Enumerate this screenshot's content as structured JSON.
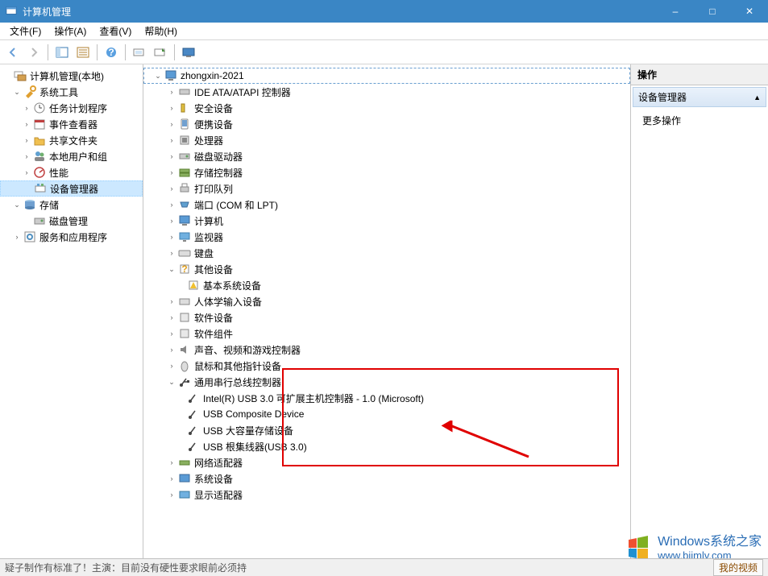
{
  "window": {
    "title": "计算机管理",
    "min": "–",
    "max": "□",
    "close": "✕"
  },
  "menu": {
    "file": "文件(F)",
    "action": "操作(A)",
    "view": "查看(V)",
    "help": "帮助(H)"
  },
  "left_tree": {
    "root": "计算机管理(本地)",
    "system_tools": "系统工具",
    "system_tools_children": {
      "task_scheduler": "任务计划程序",
      "event_viewer": "事件查看器",
      "shared_folders": "共享文件夹",
      "local_users": "本地用户和组",
      "performance": "性能",
      "device_manager": "设备管理器"
    },
    "storage": "存储",
    "storage_children": {
      "disk_mgmt": "磁盘管理"
    },
    "services_apps": "服务和应用程序"
  },
  "center_tree": {
    "root": "zhongxin-2021",
    "nodes": {
      "ide": "IDE ATA/ATAPI 控制器",
      "security": "安全设备",
      "portable": "便携设备",
      "cpu": "处理器",
      "diskdrive": "磁盘驱动器",
      "storagectrl": "存储控制器",
      "printqueue": "打印队列",
      "ports": "端口 (COM 和 LPT)",
      "computer": "计算机",
      "monitor": "监视器",
      "keyboard": "键盘",
      "other": "其他设备",
      "other_child": "基本系统设备",
      "hid": "人体学输入设备",
      "software_dev": "软件设备",
      "software_comp": "软件组件",
      "audio": "声音、视频和游戏控制器",
      "mouse": "鼠标和其他指针设备",
      "usb": "通用串行总线控制器",
      "usb_children": {
        "intel": "Intel(R) USB 3.0 可扩展主机控制器 - 1.0 (Microsoft)",
        "composite": "USB Composite Device",
        "mass_storage": "USB 大容量存储设备",
        "root_hub": "USB 根集线器(USB 3.0)"
      },
      "network": "网络适配器",
      "system_dev": "系统设备",
      "display": "显示适配器"
    }
  },
  "right_pane": {
    "header": "操作",
    "section": "设备管理器",
    "more": "更多操作"
  },
  "watermark": {
    "line1": "Windows系统之家",
    "line2": "www.bjjmlv.com"
  },
  "bottombar": {
    "left": "疑子制作有标准了！主演：目前没有硬性要求眼前必须持",
    "tab": "我的视频"
  }
}
